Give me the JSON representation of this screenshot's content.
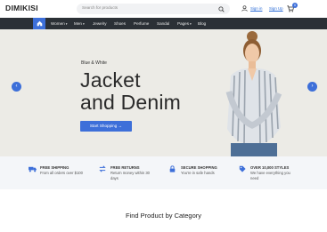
{
  "header": {
    "logo": "DIMIKISI",
    "search_placeholder": "Search for products",
    "signin_label": "Sign in",
    "signup_label": "Sign Up",
    "cart_count": "0",
    "accent_color": "#3d6fd9"
  },
  "nav": {
    "items": [
      {
        "label": "Women",
        "dropdown": true
      },
      {
        "label": "Men",
        "dropdown": true
      },
      {
        "label": "Jewelry",
        "dropdown": false
      },
      {
        "label": "Shoes",
        "dropdown": false
      },
      {
        "label": "Perfume",
        "dropdown": false
      },
      {
        "label": "Sandal",
        "dropdown": false
      },
      {
        "label": "Pages",
        "dropdown": true
      },
      {
        "label": "Blog",
        "dropdown": false
      }
    ]
  },
  "hero": {
    "eyebrow": "Blue & White",
    "title_line1": "Jacket",
    "title_line2": "and Denim",
    "button_label": "Start Shopping →"
  },
  "features": [
    {
      "title": "FREE SHIPPING",
      "text": "From all orders over $100",
      "icon": "truck-icon"
    },
    {
      "title": "FREE RETURNS",
      "text": "Return money within 30 days",
      "icon": "exchange-icon"
    },
    {
      "title": "SECURE SHOPPING",
      "text": "You're in safe hands",
      "icon": "lock-icon"
    },
    {
      "title": "OVER 10,000 STYLES",
      "text": "We have everything you need",
      "icon": "tag-icon"
    }
  ],
  "category": {
    "title": "Find Product by Category"
  }
}
